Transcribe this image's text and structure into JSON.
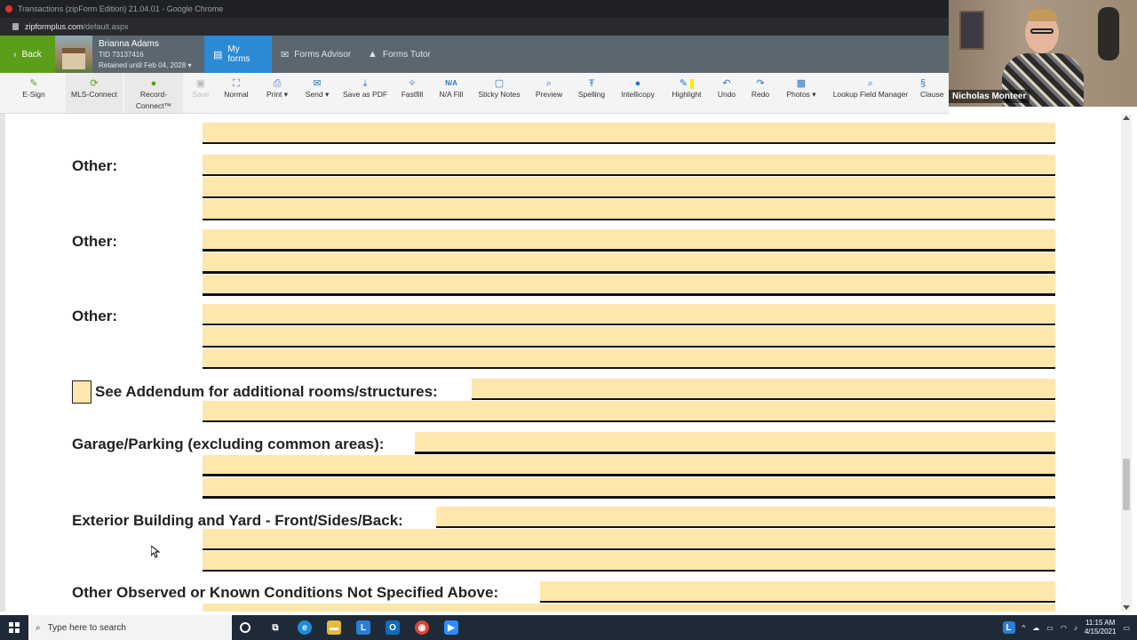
{
  "browser": {
    "title": "Transactions (zipForm Edition) 21.04.01 - Google Chrome",
    "url_host": "zipformplus.com",
    "url_path": "/default.aspx"
  },
  "header": {
    "back_label": "Back",
    "user_name": "Brianna Adams",
    "tid": "TID 73137416",
    "retained": "Retained until Feb 04, 2028 ▾",
    "tabs": [
      {
        "label": "My forms",
        "icon": "forms-icon"
      },
      {
        "label": "Forms Advisor",
        "icon": "chat-icon"
      },
      {
        "label": "Forms Tutor",
        "icon": "graduation-cap-icon"
      }
    ]
  },
  "toolbar": {
    "items": [
      {
        "label": "E-Sign",
        "icon": "pen-icon"
      },
      {
        "label": "MLS-Connect",
        "icon": "mls-icon"
      },
      {
        "label": "Record-",
        "label2": "Connect™",
        "icon": "record-icon"
      },
      {
        "label": "Save",
        "icon": "save-icon"
      },
      {
        "label": "Normal",
        "icon": "normal-view-icon"
      },
      {
        "label": "Print ▾",
        "icon": "print-icon"
      },
      {
        "label": "Send ▾",
        "icon": "send-icon"
      },
      {
        "label": "Save as PDF",
        "icon": "pdf-icon"
      },
      {
        "label": "Fastfill",
        "icon": "wand-icon"
      },
      {
        "label": "N/A Fill",
        "icon": "na-icon"
      },
      {
        "label": "Sticky Notes",
        "icon": "sticky-note-icon"
      },
      {
        "label": "Preview",
        "icon": "preview-icon"
      },
      {
        "label": "Spelling",
        "icon": "spelling-icon"
      },
      {
        "label": "Intellicopy",
        "icon": "intellicopy-icon"
      },
      {
        "label": "Highlight",
        "icon": "highlighter-icon"
      },
      {
        "label": "Undo",
        "icon": "undo-icon"
      },
      {
        "label": "Redo",
        "icon": "redo-icon"
      },
      {
        "label": "Photos ▾",
        "icon": "photos-icon"
      },
      {
        "label": "Lookup Field Manager",
        "icon": "lookup-icon"
      },
      {
        "label": "Clause",
        "icon": "clause-icon"
      }
    ]
  },
  "webcam": {
    "name": "Nicholas Monteer"
  },
  "document": {
    "other_label": "Other:",
    "addendum_label": "See Addendum for additional rooms/structures:",
    "garage_label": "Garage/Parking (excluding common areas):",
    "exterior_label": "Exterior Building and Yard - Front/Sides/Back:",
    "conditions_label": "Other Observed or Known Conditions Not Specified Above:"
  },
  "taskbar": {
    "search_placeholder": "Type here to search",
    "time": "11:15 AM",
    "date": "4/15/2021"
  }
}
